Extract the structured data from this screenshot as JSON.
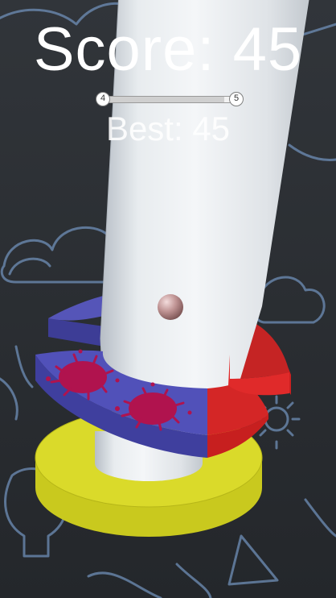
{
  "hud": {
    "score_text": "Score: 45",
    "best_text": "Best: 45",
    "level": {
      "current": "4",
      "next": "5",
      "progress": 0.92
    }
  },
  "colors": {
    "background": "#2a2d31",
    "doodle": "#6f8fb8",
    "pillar": "#e4e8ec",
    "safe_platform": "#4f4fb7",
    "danger_platform": "#e02a2a",
    "lower_platform": "#d8d823",
    "splat": "#b0134e",
    "ball": "#b98f8f"
  },
  "icons": [
    "cloud-icon",
    "gear-icon",
    "lightbulb-icon",
    "triangle-icon"
  ]
}
